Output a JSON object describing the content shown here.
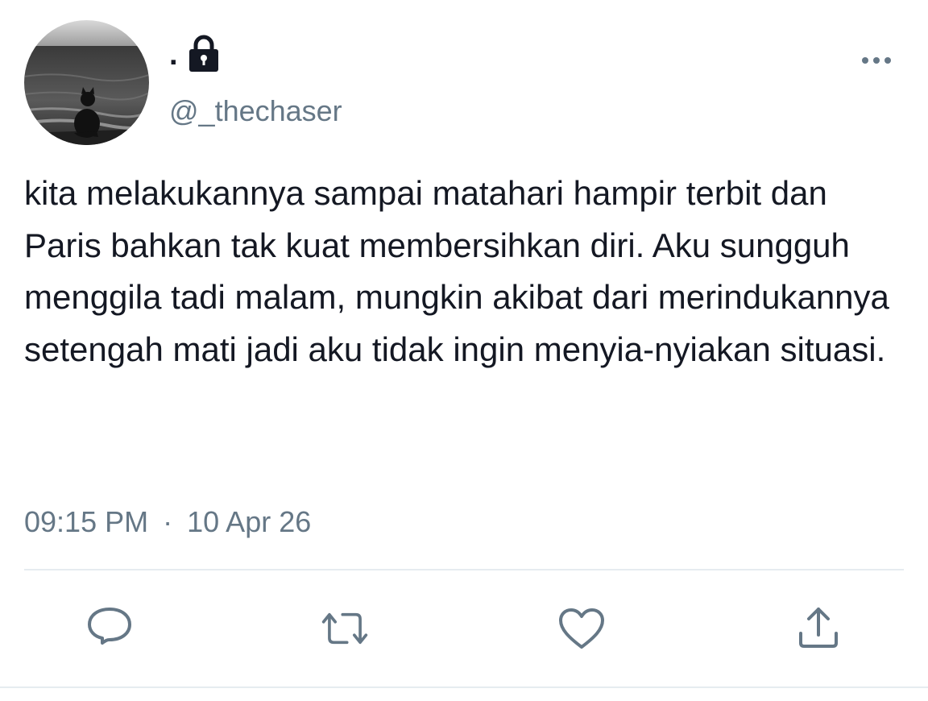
{
  "tweet": {
    "display_name": ".",
    "handle": "@_thechaser",
    "protected_icon": "lock-icon",
    "avatar": "cat-silhouette-seaside-photo",
    "text": "kita melakukannya sampai matahari hampir terbit dan Paris bahkan tak kuat membersihkan diri. Aku sungguh menggila tadi malam, mungkin akibat dari merindukannya setengah mati jadi aku tidak ingin menyia-nyiakan situasi.",
    "time": "09:15 PM",
    "separator": "·",
    "date": "10 Apr 26"
  },
  "header": {
    "more_icon": "more-horizontal-icon"
  },
  "actions": [
    {
      "name": "reply",
      "icon": "reply-icon"
    },
    {
      "name": "retweet",
      "icon": "retweet-icon"
    },
    {
      "name": "like",
      "icon": "heart-icon"
    },
    {
      "name": "share",
      "icon": "share-icon"
    }
  ],
  "colors": {
    "text_primary": "#141823",
    "text_secondary": "#657786",
    "icon": "#657786",
    "divider": "#e6ecf0",
    "background": "#ffffff"
  }
}
